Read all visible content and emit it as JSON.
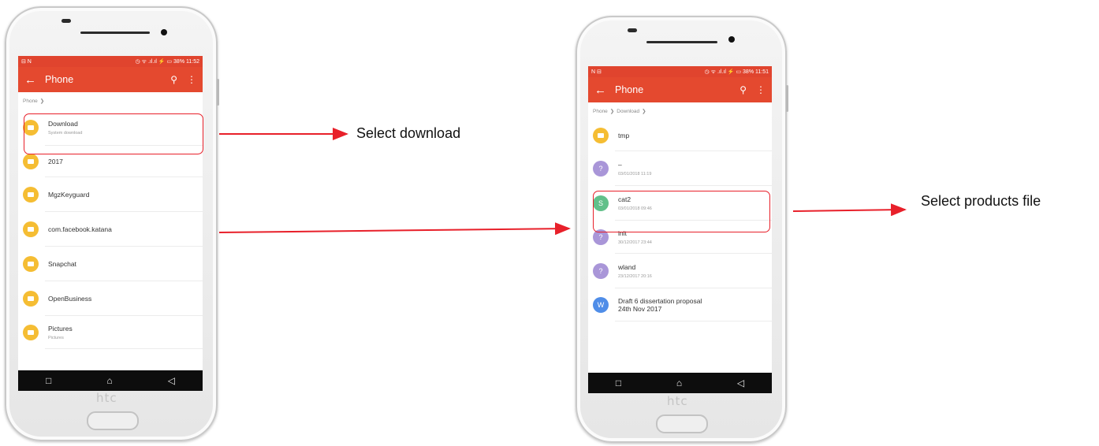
{
  "colors": {
    "accent": "#e4492f",
    "annotation": "#e8202a"
  },
  "phone_left": {
    "brand": "htc",
    "status_left": "⊟ N",
    "status_right": "◷ ᯤ .ıl.ıl ⚡ ▭ 38% 11:52",
    "title": "Phone",
    "breadcrumb": [
      "Phone"
    ],
    "items": [
      {
        "name": "Download",
        "sub": "System download",
        "icon": "folder-icon"
      },
      {
        "name": "2017",
        "sub": "",
        "icon": "folder-icon"
      },
      {
        "name": "MgzKeyguard",
        "sub": "",
        "icon": "folder-icon"
      },
      {
        "name": "com.facebook.katana",
        "sub": "",
        "icon": "folder-icon"
      },
      {
        "name": "Snapchat",
        "sub": "",
        "icon": "folder-icon"
      },
      {
        "name": "OpenBusiness",
        "sub": "",
        "icon": "folder-icon"
      },
      {
        "name": "Pictures",
        "sub": "Pictures",
        "icon": "folder-icon"
      }
    ]
  },
  "phone_right": {
    "brand": "htc",
    "status_left": "N ⊟",
    "status_right": "◷ ᯤ .ıl.ıl ⚡ ▭ 38% 11:51",
    "title": "Phone",
    "breadcrumb": [
      "Phone",
      "Download"
    ],
    "items": [
      {
        "name": "tmp",
        "sub": "",
        "icon": "folder-icon"
      },
      {
        "name": "–",
        "sub": "03/01/2018 11:19",
        "icon": "unknown-file-icon"
      },
      {
        "name": "cat2",
        "sub": "03/01/2018 09:46",
        "icon": "spreadsheet-icon"
      },
      {
        "name": "init",
        "sub": "30/12/2017 23:44",
        "icon": "unknown-file-icon"
      },
      {
        "name": "wland",
        "sub": "23/12/2017 20:16",
        "icon": "unknown-file-icon"
      },
      {
        "name": "Draft 6 dissertation proposal\n24th Nov 2017",
        "sub": "",
        "icon": "word-document-icon"
      }
    ]
  },
  "icons": {
    "folder": "▬",
    "unknown": "?",
    "sheet": "S",
    "doc": "W"
  },
  "nav": {
    "recent": "□",
    "home": "⌂",
    "back": "◁"
  },
  "appbar_icons": {
    "back": "←",
    "search": "⚲",
    "more": "⋮"
  },
  "annotations": {
    "step1": "Select download",
    "step2": "Select products file"
  }
}
